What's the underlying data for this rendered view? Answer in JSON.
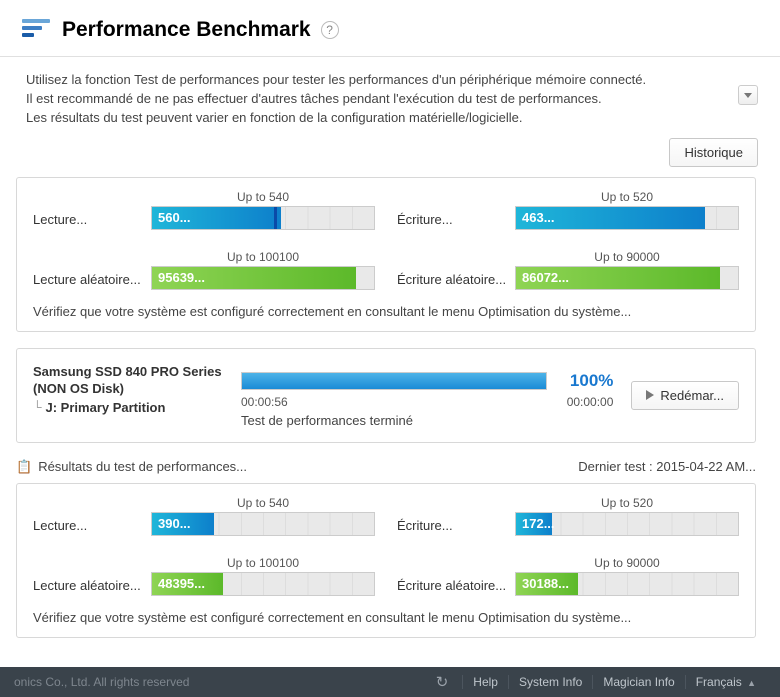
{
  "header": {
    "title": "Performance Benchmark"
  },
  "intro": {
    "line1": "Utilisez la fonction Test de performances pour tester les performances d'un périphérique mémoire connecté.",
    "line2": "Il est recommandé de ne pas effectuer d'autres tâches pendant l'exécution du test de performances.",
    "line3": "Les résultats du test peuvent varier en fonction de la configuration matérielle/logicielle."
  },
  "buttons": {
    "history": "Historique",
    "restart": "Redémar..."
  },
  "bench_upper": {
    "read": {
      "label": "Lecture...",
      "upto": "Up to 540",
      "value": "560...",
      "color": "blue",
      "fillPct": 58,
      "markPct": 55
    },
    "write": {
      "label": "Écriture...",
      "upto": "Up to 520",
      "value": "463...",
      "color": "blue",
      "fillPct": 85,
      "markPct": null
    },
    "rread": {
      "label": "Lecture aléatoire...",
      "upto": "Up to 100100",
      "value": "95639...",
      "color": "green",
      "fillPct": 92,
      "markPct": null
    },
    "rwrite": {
      "label": "Écriture aléatoire...",
      "upto": "Up to 90000",
      "value": "86072...",
      "color": "green",
      "fillPct": 92,
      "markPct": null
    }
  },
  "config_note": "Vérifiez que votre système est configuré correctement en consultant le menu Optimisation du système...",
  "drive": {
    "name": "Samsung SSD 840 PRO Series  (NON OS Disk)",
    "partition": "J: Primary Partition",
    "elapsed": "00:00:56",
    "remaining": "00:00:00",
    "progressPct": 100,
    "progressText": "100%",
    "status": "Test de performances terminé"
  },
  "results_head": {
    "title": "Résultats du test de performances...",
    "last": "Dernier test : 2015-04-22 AM..."
  },
  "bench_lower": {
    "read": {
      "label": "Lecture...",
      "upto": "Up to 540",
      "value": "390...",
      "color": "blue",
      "fillPct": 28,
      "markPct": null
    },
    "write": {
      "label": "Écriture...",
      "upto": "Up to 520",
      "value": "172...",
      "color": "blue",
      "fillPct": 16,
      "markPct": null
    },
    "rread": {
      "label": "Lecture aléatoire...",
      "upto": "Up to 100100",
      "value": "48395...",
      "color": "green",
      "fillPct": 32,
      "markPct": null
    },
    "rwrite": {
      "label": "Écriture aléatoire...",
      "upto": "Up to 90000",
      "value": "30188...",
      "color": "green",
      "fillPct": 28,
      "markPct": null
    }
  },
  "footer": {
    "copyright": "onics Co., Ltd. All rights reserved",
    "links": {
      "help": "Help",
      "sysinfo": "System Info",
      "maginfo": "Magician Info",
      "lang": "Français"
    }
  }
}
